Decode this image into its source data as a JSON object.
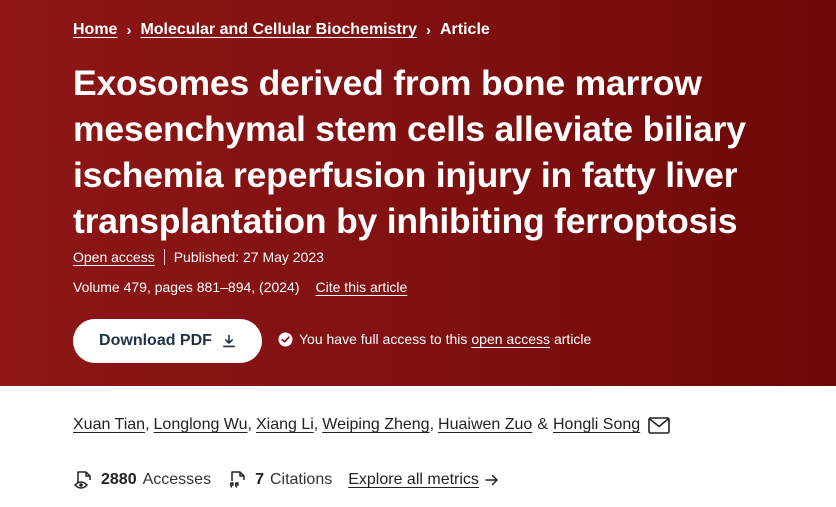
{
  "breadcrumb": {
    "home": "Home",
    "separator": "›",
    "journal": "Molecular and Cellular Biochemistry",
    "current": "Article"
  },
  "article": {
    "title": "Exosomes derived from bone marrow mesenchymal stem cells alleviate biliary ischemia reperfusion injury in fatty liver transplantation by inhibiting ferroptosis",
    "access_type": "Open access",
    "published": "Published: 27 May 2023",
    "volume_pages": "Volume 479, pages 881–894, (2024)",
    "cite_label": "Cite this article",
    "download_label": "Download PDF",
    "access_prefix": "You have full access to this",
    "access_link": "open access",
    "access_suffix": "article"
  },
  "authors": [
    {
      "name": "Xuan Tian"
    },
    {
      "name": "Longlong Wu"
    },
    {
      "name": "Xiang Li"
    },
    {
      "name": "Weiping Zheng"
    },
    {
      "name": "Huaiwen Zuo"
    },
    {
      "name": "Hongli Song"
    }
  ],
  "authors_amp": "&",
  "metrics": {
    "accesses_count": "2880",
    "accesses_label": "Accesses",
    "citations_count": "7",
    "citations_label": "Citations",
    "explore_label": "Explore all metrics"
  },
  "colors": {
    "hero_background": "#8a1414",
    "button_text": "#1f3347",
    "text": "#222222"
  },
  "icons": {
    "download": "download-icon",
    "check": "check-circle-icon",
    "mail": "mail-icon",
    "accesses": "eye-document-icon",
    "citations": "quote-document-icon",
    "arrow": "arrow-right-icon"
  }
}
